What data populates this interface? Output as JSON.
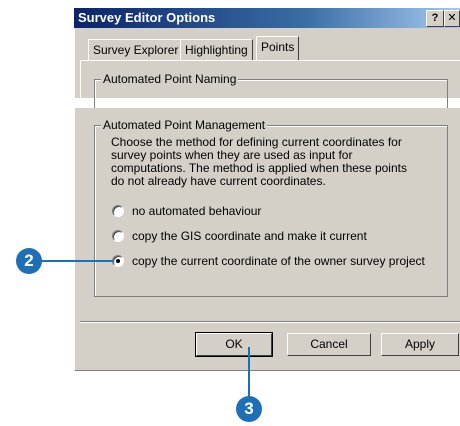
{
  "dialog": {
    "title": "Survey Editor Options",
    "help_button": "?",
    "close_button": "✕",
    "tabs": [
      {
        "label": "Survey Explorer"
      },
      {
        "label": "Highlighting"
      },
      {
        "label": "Points"
      }
    ],
    "groups": {
      "naming_legend": "Automated Point Naming",
      "management_legend": "Automated Point Management"
    },
    "description": "Choose the method for defining current coordinates for survey points when they are used as input for computations. The method is applied when these points do not already have current coordinates.",
    "radios": [
      {
        "label": "no automated behaviour",
        "selected": false
      },
      {
        "label": "copy the GIS coordinate and make it current",
        "selected": false
      },
      {
        "label": "copy the current coordinate of the owner survey project",
        "selected": true
      }
    ],
    "buttons": {
      "ok": "OK",
      "cancel": "Cancel",
      "apply": "Apply"
    }
  },
  "callouts": {
    "step2": "2",
    "step3": "3"
  },
  "colors": {
    "callout": "#1e6fb6",
    "dialog_face": "#d4d0c8",
    "titlebar": "#0a246a"
  }
}
